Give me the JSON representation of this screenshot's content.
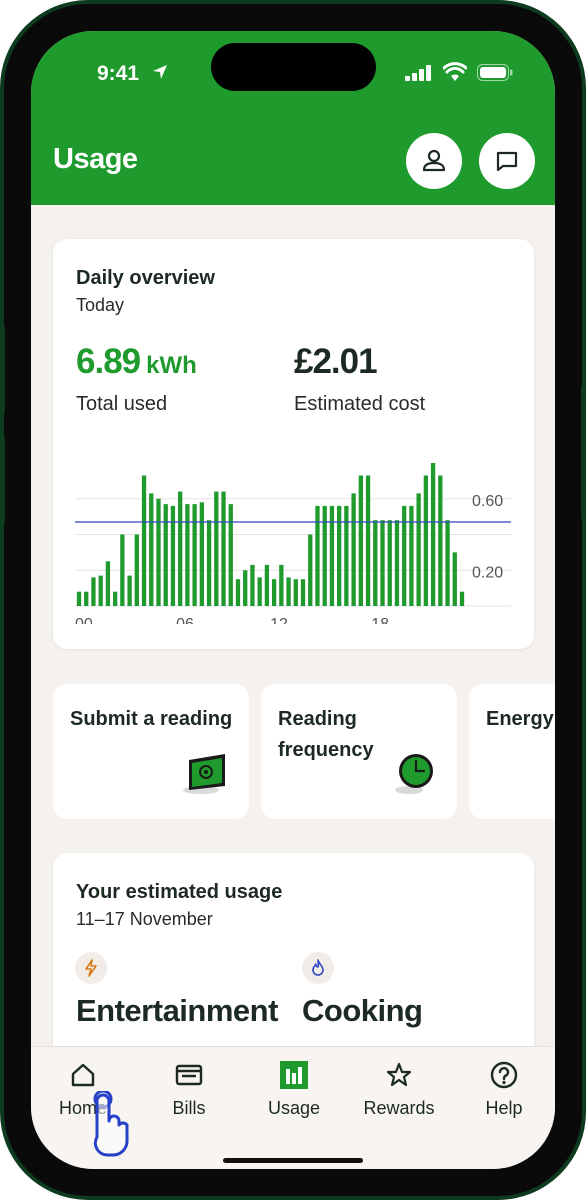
{
  "status_bar": {
    "time": "9:41"
  },
  "header": {
    "title": "Usage",
    "profile_icon": "profile-icon",
    "chat_icon": "chat-icon"
  },
  "daily_overview": {
    "title": "Daily overview",
    "subtitle": "Today",
    "total_value": "6.89",
    "total_unit": "kWh",
    "total_label": "Total used",
    "cost_value": "£2.01",
    "cost_label": "Estimated cost"
  },
  "chart_data": {
    "type": "bar",
    "x_tick_labels": [
      "00",
      "06",
      "12",
      "18"
    ],
    "y_tick_labels": [
      "0.60",
      "0.20"
    ],
    "ylim": [
      0,
      0.8
    ],
    "reference_line": 0.47,
    "values": [
      0.08,
      0.08,
      0.16,
      0.17,
      0.25,
      0.08,
      0.4,
      0.17,
      0.4,
      0.73,
      0.63,
      0.6,
      0.57,
      0.56,
      0.64,
      0.57,
      0.57,
      0.58,
      0.48,
      0.64,
      0.64,
      0.57,
      0.15,
      0.2,
      0.23,
      0.16,
      0.23,
      0.15,
      0.23,
      0.16,
      0.15,
      0.15,
      0.4,
      0.56,
      0.56,
      0.56,
      0.56,
      0.56,
      0.63,
      0.73,
      0.73,
      0.48,
      0.48,
      0.48,
      0.48,
      0.56,
      0.56,
      0.63,
      0.73,
      0.8,
      0.73,
      0.48,
      0.3,
      0.08
    ],
    "colors": {
      "bars": "#1f9a2d",
      "reference_line": "#3346c4",
      "grid": "#e3e3e3"
    }
  },
  "tiles": [
    {
      "label": "Submit a reading"
    },
    {
      "label": "Reading frequency"
    },
    {
      "label": "Energy assessm"
    }
  ],
  "estimated_usage": {
    "title": "Your estimated usage",
    "date_range": "11–17 November",
    "items": [
      {
        "name": "Entertainment",
        "icon": "lightning-icon"
      },
      {
        "name": "Cooking",
        "icon": "flame-icon"
      }
    ]
  },
  "tabbar": {
    "items": [
      {
        "label": "Home",
        "icon": "home-icon"
      },
      {
        "label": "Bills",
        "icon": "wallet-icon"
      },
      {
        "label": "Usage",
        "icon": "bar-chart-icon",
        "active": true
      },
      {
        "label": "Rewards",
        "icon": "star-icon"
      },
      {
        "label": "Help",
        "icon": "help-icon"
      }
    ]
  },
  "colors": {
    "brand_green": "#1f9a2d",
    "phone_frame": "#0d3b1e",
    "background": "#f4f1ee",
    "text_dark": "#1c2a22"
  }
}
